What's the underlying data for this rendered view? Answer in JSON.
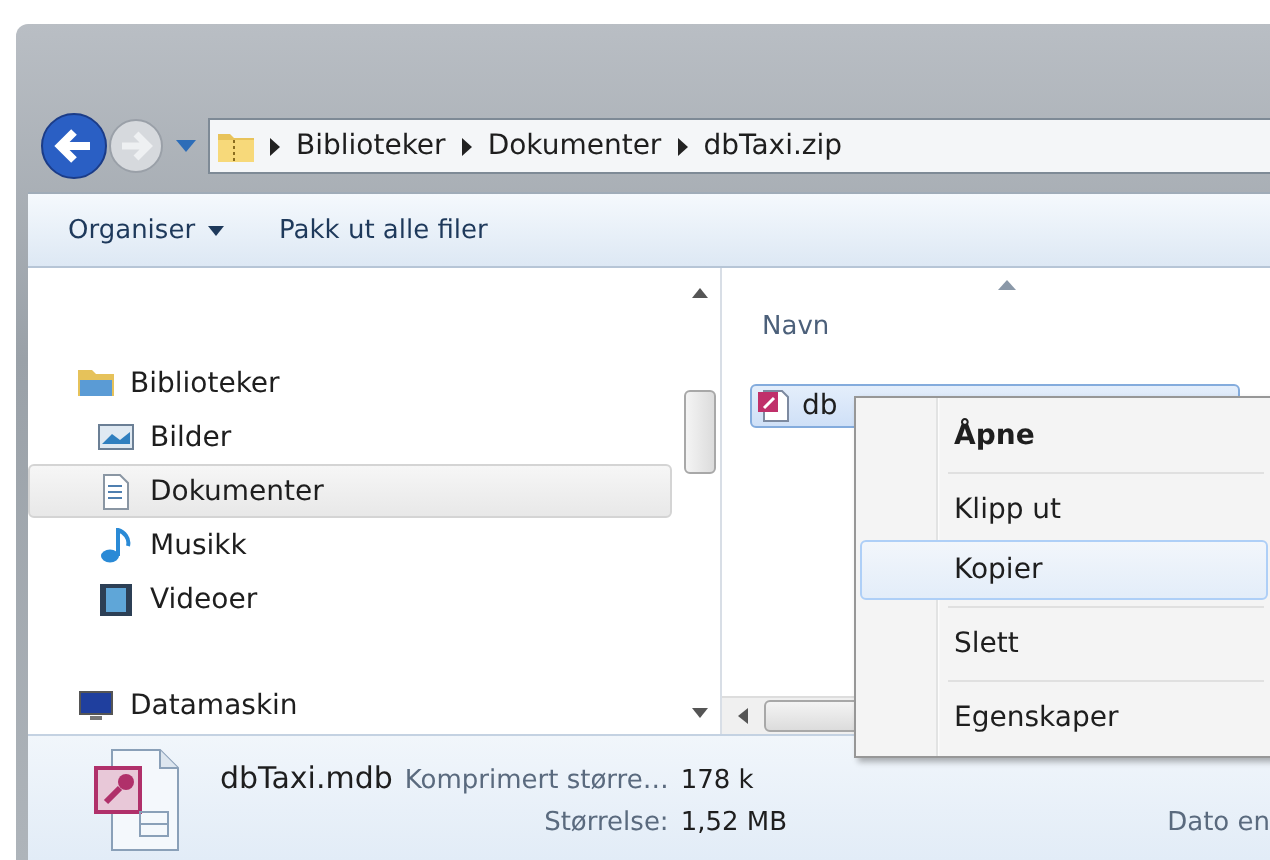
{
  "address": {
    "segments": [
      "Biblioteker",
      "Dokumenter",
      "dbTaxi.zip"
    ]
  },
  "toolbar": {
    "buttons": [
      {
        "label": "Organiser",
        "kind": "dropdown"
      },
      {
        "label": "Pakk ut alle filer",
        "kind": "plain"
      }
    ]
  },
  "nav": {
    "items": [
      {
        "label": "Biblioteker",
        "kind": "library",
        "selected": false,
        "children": [
          {
            "label": "Bilder",
            "kind": "pictures",
            "selected": false
          },
          {
            "label": "Dokumenter",
            "kind": "documents",
            "selected": true
          },
          {
            "label": "Musikk",
            "kind": "music",
            "selected": false
          },
          {
            "label": "Videoer",
            "kind": "videos",
            "selected": false
          }
        ]
      },
      {
        "label": "Datamaskin",
        "kind": "computer",
        "selected": false
      }
    ]
  },
  "files": {
    "column": "Navn",
    "items": [
      {
        "name": "db",
        "selected": true
      }
    ]
  },
  "context_menu": {
    "items": [
      {
        "kind": "default",
        "label": "Åpne",
        "selected": false
      },
      {
        "kind": "separator"
      },
      {
        "kind": "item",
        "label": "Klipp ut",
        "selected": false
      },
      {
        "kind": "item",
        "label": "Kopier",
        "selected": true
      },
      {
        "kind": "separator"
      },
      {
        "kind": "item",
        "label": "Slett",
        "selected": false
      },
      {
        "kind": "separator"
      },
      {
        "kind": "item",
        "label": "Egenskaper",
        "selected": false
      }
    ]
  },
  "details": {
    "name": "dbTaxi.mdb",
    "fields": [
      {
        "label": "Komprimert større…",
        "value": "178 k"
      },
      {
        "label": "Størrelse:",
        "value": "1,52 MB"
      },
      {
        "label": "Dato en"
      }
    ]
  }
}
